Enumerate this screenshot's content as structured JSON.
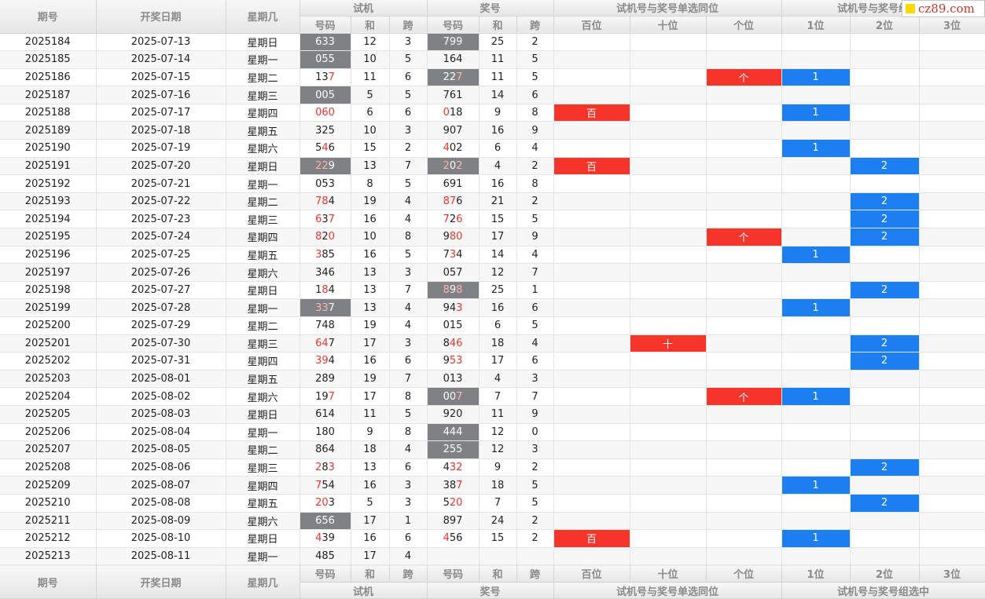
{
  "header": {
    "issue": "期号",
    "date": "开奖日期",
    "weekday": "星期几",
    "trial": "试机",
    "draw": "奖号",
    "single": "试机号与奖号单选同位",
    "group": "试机号与奖号组选中",
    "sub_num": "号码",
    "sub_sum": "和",
    "sub_span": "跨",
    "pos_bai": "百位",
    "pos_shi": "十位",
    "pos_ge": "个位",
    "pos_1": "1位",
    "pos_2": "2位",
    "pos_3": "3位"
  },
  "logo": {
    "text": "cz89.com",
    "color": "#ffd800"
  },
  "colors": {
    "highlight": "#7f8184",
    "red": "#f5352a",
    "blue": "#1b7ff0",
    "match_digit": "#e8382d"
  },
  "rows": [
    {
      "issue": "2025184",
      "date": "2025-07-13",
      "wd": "星期日",
      "t": "633",
      "ts": "12",
      "tk": "3",
      "thl": true,
      "d": "799",
      "ds": "25",
      "dk": "2",
      "dhl": true,
      "tr": [],
      "dr": [],
      "bai": "",
      "shi": "",
      "ge": "",
      "p1": "",
      "p2": "",
      "p3": ""
    },
    {
      "issue": "2025185",
      "date": "2025-07-14",
      "wd": "星期一",
      "t": "055",
      "ts": "10",
      "tk": "5",
      "thl": true,
      "d": "164",
      "ds": "11",
      "dk": "5",
      "dhl": false,
      "tr": [],
      "dr": [],
      "bai": "",
      "shi": "",
      "ge": "",
      "p1": "",
      "p2": "",
      "p3": ""
    },
    {
      "issue": "2025186",
      "date": "2025-07-15",
      "wd": "星期二",
      "t": "137",
      "ts": "11",
      "tk": "6",
      "thl": false,
      "d": "227",
      "ds": "11",
      "dk": "5",
      "dhl": true,
      "tr": [
        2
      ],
      "dr": [
        2
      ],
      "bai": "",
      "shi": "",
      "ge": "个",
      "p1": "1",
      "p2": "",
      "p3": ""
    },
    {
      "issue": "2025187",
      "date": "2025-07-16",
      "wd": "星期三",
      "t": "005",
      "ts": "5",
      "tk": "5",
      "thl": true,
      "d": "761",
      "ds": "14",
      "dk": "6",
      "dhl": false,
      "tr": [],
      "dr": [],
      "bai": "",
      "shi": "",
      "ge": "",
      "p1": "",
      "p2": "",
      "p3": ""
    },
    {
      "issue": "2025188",
      "date": "2025-07-17",
      "wd": "星期四",
      "t": "060",
      "ts": "6",
      "tk": "6",
      "thl": false,
      "d": "018",
      "ds": "9",
      "dk": "8",
      "dhl": false,
      "tr": [
        0,
        1,
        2
      ],
      "dr": [
        0
      ],
      "bai": "百",
      "shi": "",
      "ge": "",
      "p1": "1",
      "p2": "",
      "p3": ""
    },
    {
      "issue": "2025189",
      "date": "2025-07-18",
      "wd": "星期五",
      "t": "325",
      "ts": "10",
      "tk": "3",
      "thl": false,
      "d": "907",
      "ds": "16",
      "dk": "9",
      "dhl": false,
      "tr": [],
      "dr": [],
      "bai": "",
      "shi": "",
      "ge": "",
      "p1": "",
      "p2": "",
      "p3": ""
    },
    {
      "issue": "2025190",
      "date": "2025-07-19",
      "wd": "星期六",
      "t": "546",
      "ts": "15",
      "tk": "2",
      "thl": false,
      "d": "402",
      "ds": "6",
      "dk": "4",
      "dhl": false,
      "tr": [
        1
      ],
      "dr": [
        0
      ],
      "bai": "",
      "shi": "",
      "ge": "",
      "p1": "1",
      "p2": "",
      "p3": ""
    },
    {
      "issue": "2025191",
      "date": "2025-07-20",
      "wd": "星期日",
      "t": "229",
      "ts": "13",
      "tk": "7",
      "thl": true,
      "d": "202",
      "ds": "4",
      "dk": "2",
      "dhl": true,
      "tr": [
        0,
        1
      ],
      "dr": [
        0,
        2
      ],
      "bai": "百",
      "shi": "",
      "ge": "",
      "p1": "",
      "p2": "2",
      "p3": ""
    },
    {
      "issue": "2025192",
      "date": "2025-07-21",
      "wd": "星期一",
      "t": "053",
      "ts": "8",
      "tk": "5",
      "thl": false,
      "d": "691",
      "ds": "16",
      "dk": "8",
      "dhl": false,
      "tr": [],
      "dr": [],
      "bai": "",
      "shi": "",
      "ge": "",
      "p1": "",
      "p2": "",
      "p3": ""
    },
    {
      "issue": "2025193",
      "date": "2025-07-22",
      "wd": "星期二",
      "t": "784",
      "ts": "19",
      "tk": "4",
      "thl": false,
      "d": "876",
      "ds": "21",
      "dk": "2",
      "dhl": false,
      "tr": [
        0,
        1
      ],
      "dr": [
        0,
        1
      ],
      "bai": "",
      "shi": "",
      "ge": "",
      "p1": "",
      "p2": "2",
      "p3": ""
    },
    {
      "issue": "2025194",
      "date": "2025-07-23",
      "wd": "星期三",
      "t": "637",
      "ts": "16",
      "tk": "4",
      "thl": false,
      "d": "726",
      "ds": "15",
      "dk": "5",
      "dhl": false,
      "tr": [
        0,
        2
      ],
      "dr": [
        0,
        2
      ],
      "bai": "",
      "shi": "",
      "ge": "",
      "p1": "",
      "p2": "2",
      "p3": ""
    },
    {
      "issue": "2025195",
      "date": "2025-07-24",
      "wd": "星期四",
      "t": "820",
      "ts": "10",
      "tk": "8",
      "thl": false,
      "d": "980",
      "ds": "17",
      "dk": "9",
      "dhl": false,
      "tr": [
        0,
        2
      ],
      "dr": [
        1,
        2
      ],
      "bai": "",
      "shi": "",
      "ge": "个",
      "p1": "",
      "p2": "2",
      "p3": ""
    },
    {
      "issue": "2025196",
      "date": "2025-07-25",
      "wd": "星期五",
      "t": "385",
      "ts": "16",
      "tk": "5",
      "thl": false,
      "d": "734",
      "ds": "14",
      "dk": "4",
      "dhl": false,
      "tr": [
        0
      ],
      "dr": [
        1
      ],
      "bai": "",
      "shi": "",
      "ge": "",
      "p1": "1",
      "p2": "",
      "p3": ""
    },
    {
      "issue": "2025197",
      "date": "2025-07-26",
      "wd": "星期六",
      "t": "346",
      "ts": "13",
      "tk": "3",
      "thl": false,
      "d": "057",
      "ds": "12",
      "dk": "7",
      "dhl": false,
      "tr": [],
      "dr": [],
      "bai": "",
      "shi": "",
      "ge": "",
      "p1": "",
      "p2": "",
      "p3": ""
    },
    {
      "issue": "2025198",
      "date": "2025-07-27",
      "wd": "星期日",
      "t": "184",
      "ts": "13",
      "tk": "7",
      "thl": false,
      "d": "898",
      "ds": "25",
      "dk": "1",
      "dhl": true,
      "tr": [
        1
      ],
      "dr": [
        0,
        2
      ],
      "bai": "",
      "shi": "",
      "ge": "",
      "p1": "",
      "p2": "2",
      "p3": ""
    },
    {
      "issue": "2025199",
      "date": "2025-07-28",
      "wd": "星期一",
      "t": "337",
      "ts": "13",
      "tk": "4",
      "thl": true,
      "d": "943",
      "ds": "16",
      "dk": "6",
      "dhl": false,
      "tr": [
        0,
        1
      ],
      "dr": [
        2
      ],
      "bai": "",
      "shi": "",
      "ge": "",
      "p1": "1",
      "p2": "",
      "p3": ""
    },
    {
      "issue": "2025200",
      "date": "2025-07-29",
      "wd": "星期二",
      "t": "748",
      "ts": "19",
      "tk": "4",
      "thl": false,
      "d": "015",
      "ds": "6",
      "dk": "5",
      "dhl": false,
      "tr": [],
      "dr": [],
      "bai": "",
      "shi": "",
      "ge": "",
      "p1": "",
      "p2": "",
      "p3": ""
    },
    {
      "issue": "2025201",
      "date": "2025-07-30",
      "wd": "星期三",
      "t": "647",
      "ts": "17",
      "tk": "3",
      "thl": false,
      "d": "846",
      "ds": "18",
      "dk": "4",
      "dhl": false,
      "tr": [
        0,
        1
      ],
      "dr": [
        1,
        2
      ],
      "bai": "",
      "shi": "十",
      "ge": "",
      "p1": "",
      "p2": "2",
      "p3": ""
    },
    {
      "issue": "2025202",
      "date": "2025-07-31",
      "wd": "星期四",
      "t": "394",
      "ts": "16",
      "tk": "6",
      "thl": false,
      "d": "953",
      "ds": "17",
      "dk": "6",
      "dhl": false,
      "tr": [
        0,
        1
      ],
      "dr": [
        1,
        2
      ],
      "bai": "",
      "shi": "",
      "ge": "",
      "p1": "",
      "p2": "2",
      "p3": ""
    },
    {
      "issue": "2025203",
      "date": "2025-08-01",
      "wd": "星期五",
      "t": "289",
      "ts": "19",
      "tk": "7",
      "thl": false,
      "d": "013",
      "ds": "4",
      "dk": "3",
      "dhl": false,
      "tr": [],
      "dr": [],
      "bai": "",
      "shi": "",
      "ge": "",
      "p1": "",
      "p2": "",
      "p3": ""
    },
    {
      "issue": "2025204",
      "date": "2025-08-02",
      "wd": "星期六",
      "t": "197",
      "ts": "17",
      "tk": "8",
      "thl": false,
      "d": "007",
      "ds": "7",
      "dk": "7",
      "dhl": true,
      "tr": [
        2
      ],
      "dr": [
        2
      ],
      "bai": "",
      "shi": "",
      "ge": "个",
      "p1": "1",
      "p2": "",
      "p3": ""
    },
    {
      "issue": "2025205",
      "date": "2025-08-03",
      "wd": "星期日",
      "t": "614",
      "ts": "11",
      "tk": "5",
      "thl": false,
      "d": "920",
      "ds": "11",
      "dk": "9",
      "dhl": false,
      "tr": [],
      "dr": [],
      "bai": "",
      "shi": "",
      "ge": "",
      "p1": "",
      "p2": "",
      "p3": ""
    },
    {
      "issue": "2025206",
      "date": "2025-08-04",
      "wd": "星期一",
      "t": "180",
      "ts": "9",
      "tk": "8",
      "thl": false,
      "d": "444",
      "ds": "12",
      "dk": "0",
      "dhl": true,
      "tr": [],
      "dr": [],
      "bai": "",
      "shi": "",
      "ge": "",
      "p1": "",
      "p2": "",
      "p3": ""
    },
    {
      "issue": "2025207",
      "date": "2025-08-05",
      "wd": "星期二",
      "t": "864",
      "ts": "18",
      "tk": "4",
      "thl": false,
      "d": "255",
      "ds": "12",
      "dk": "3",
      "dhl": true,
      "tr": [],
      "dr": [],
      "bai": "",
      "shi": "",
      "ge": "",
      "p1": "",
      "p2": "",
      "p3": ""
    },
    {
      "issue": "2025208",
      "date": "2025-08-06",
      "wd": "星期三",
      "t": "283",
      "ts": "13",
      "tk": "6",
      "thl": false,
      "d": "432",
      "ds": "9",
      "dk": "2",
      "dhl": false,
      "tr": [
        0,
        2
      ],
      "dr": [
        1,
        2
      ],
      "bai": "",
      "shi": "",
      "ge": "",
      "p1": "",
      "p2": "2",
      "p3": ""
    },
    {
      "issue": "2025209",
      "date": "2025-08-07",
      "wd": "星期四",
      "t": "754",
      "ts": "16",
      "tk": "3",
      "thl": false,
      "d": "387",
      "ds": "18",
      "dk": "5",
      "dhl": false,
      "tr": [
        0
      ],
      "dr": [
        2
      ],
      "bai": "",
      "shi": "",
      "ge": "",
      "p1": "1",
      "p2": "",
      "p3": ""
    },
    {
      "issue": "2025210",
      "date": "2025-08-08",
      "wd": "星期五",
      "t": "203",
      "ts": "5",
      "tk": "3",
      "thl": false,
      "d": "520",
      "ds": "7",
      "dk": "5",
      "dhl": false,
      "tr": [
        0,
        1
      ],
      "dr": [
        1,
        2
      ],
      "bai": "",
      "shi": "",
      "ge": "",
      "p1": "",
      "p2": "2",
      "p3": ""
    },
    {
      "issue": "2025211",
      "date": "2025-08-09",
      "wd": "星期六",
      "t": "656",
      "ts": "17",
      "tk": "1",
      "thl": true,
      "d": "897",
      "ds": "24",
      "dk": "2",
      "dhl": false,
      "tr": [],
      "dr": [],
      "bai": "",
      "shi": "",
      "ge": "",
      "p1": "",
      "p2": "",
      "p3": ""
    },
    {
      "issue": "2025212",
      "date": "2025-08-10",
      "wd": "星期日",
      "t": "439",
      "ts": "16",
      "tk": "6",
      "thl": false,
      "d": "456",
      "ds": "15",
      "dk": "2",
      "dhl": false,
      "tr": [
        0
      ],
      "dr": [
        0
      ],
      "bai": "百",
      "shi": "",
      "ge": "",
      "p1": "1",
      "p2": "",
      "p3": ""
    },
    {
      "issue": "2025213",
      "date": "2025-08-11",
      "wd": "星期一",
      "t": "485",
      "ts": "17",
      "tk": "4",
      "thl": false,
      "d": "",
      "ds": "",
      "dk": "",
      "dhl": false,
      "tr": [],
      "dr": [],
      "bai": "",
      "shi": "",
      "ge": "",
      "p1": "",
      "p2": "",
      "p3": ""
    }
  ]
}
